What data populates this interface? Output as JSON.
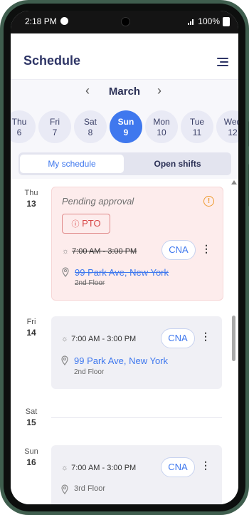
{
  "status_bar": {
    "time": "2:18 PM",
    "battery": "100%"
  },
  "header": {
    "title": "Schedule"
  },
  "calendar": {
    "month": "March",
    "days": [
      {
        "name": "Thu",
        "date": "6"
      },
      {
        "name": "Fri",
        "date": "7"
      },
      {
        "name": "Sat",
        "date": "8"
      },
      {
        "name": "Sun",
        "date": "9",
        "selected": true
      },
      {
        "name": "Mon",
        "date": "10"
      },
      {
        "name": "Tue",
        "date": "11"
      },
      {
        "name": "Wed",
        "date": "12"
      }
    ]
  },
  "tabs": {
    "my_schedule": "My schedule",
    "open_shifts": "Open shifts",
    "active": "My schedule"
  },
  "entries": [
    {
      "day": "Thu",
      "date": "13",
      "status": "Pending approval",
      "badge": "PTO",
      "time": "7:00 AM - 3:00 PM",
      "role": "CNA",
      "address": "99 Park Ave, New York",
      "floor": "2nd Floor",
      "cancelled": true
    },
    {
      "day": "Fri",
      "date": "14",
      "time": "7:00 AM - 3:00 PM",
      "role": "CNA",
      "address": "99 Park Ave, New York",
      "floor": "2nd Floor"
    },
    {
      "day": "Sat",
      "date": "15"
    },
    {
      "day": "Sun",
      "date": "16",
      "time": "7:00 AM - 3:00 PM",
      "role": "CNA",
      "floor": "3rd Floor"
    }
  ],
  "colors": {
    "accent": "#3f78ee",
    "title": "#2e3566",
    "pending_bg": "#fdecec",
    "warning": "#ee9a2f",
    "pto": "#d84848"
  }
}
